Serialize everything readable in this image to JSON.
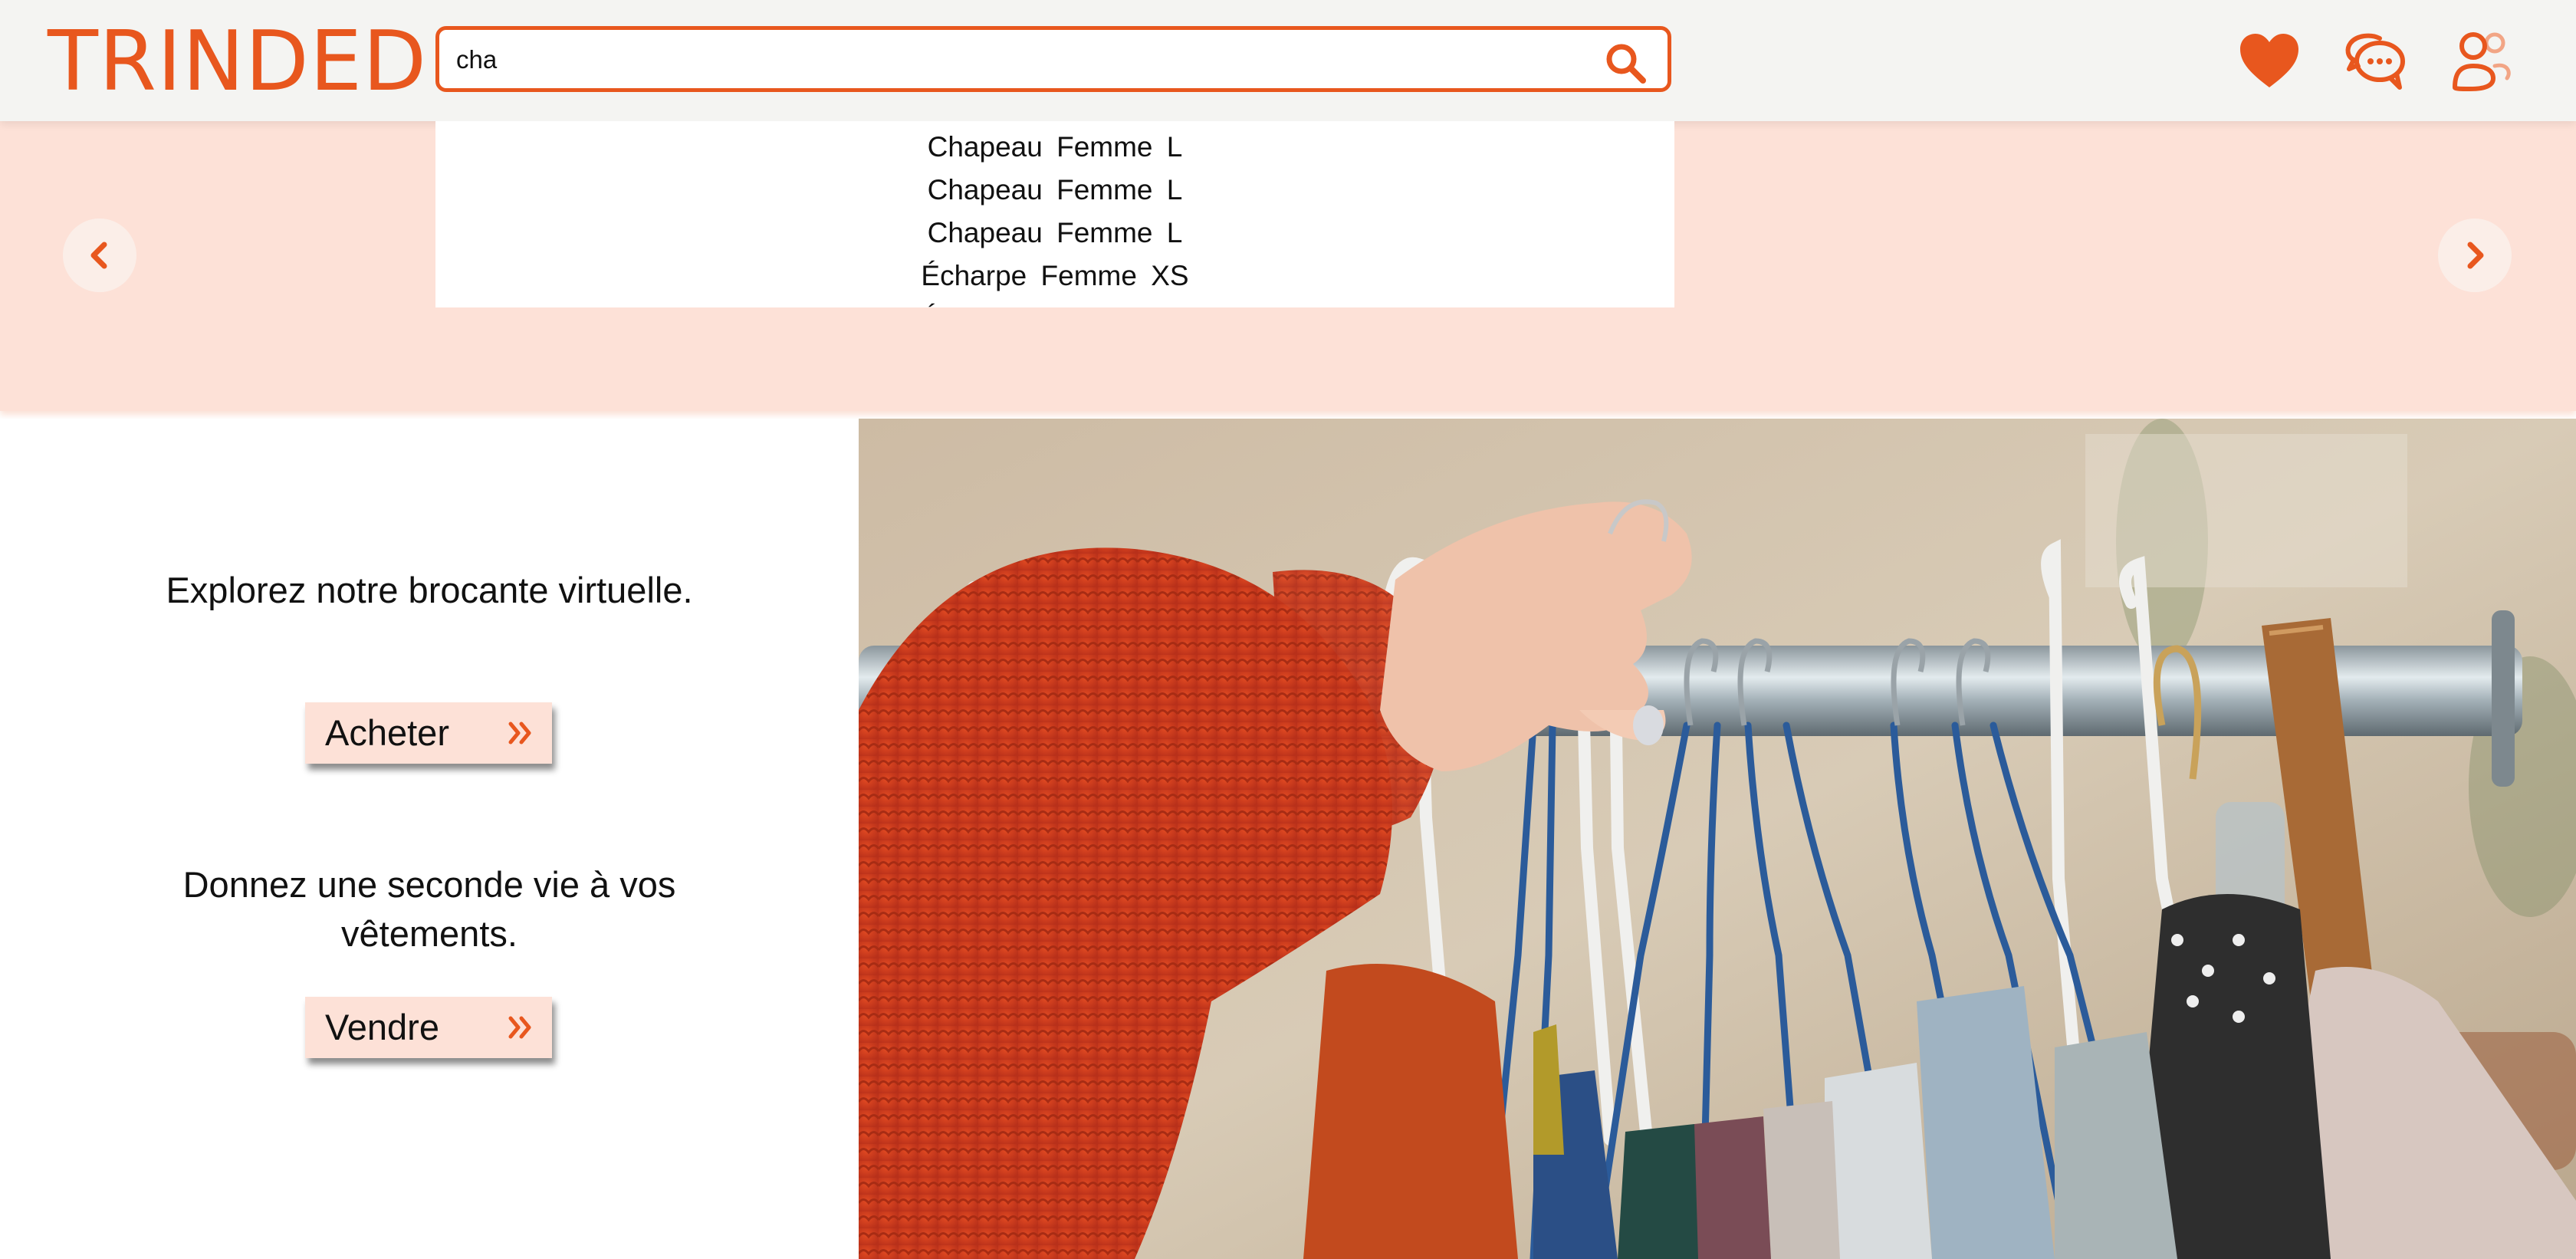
{
  "brand": {
    "name": "TRINDED",
    "accent": "#e8571e",
    "soft": "#fde1d7"
  },
  "search": {
    "value": "cha",
    "placeholder": ""
  },
  "header_icons": [
    "search-icon",
    "heart-icon",
    "chat-icon",
    "users-icon"
  ],
  "suggestions": [
    "Chapeau Femme L",
    "Chapeau Femme L",
    "Chapeau Femme L",
    "Écharpe Femme XS",
    "Écharpe Femme XS"
  ],
  "carousel": {
    "prev_icon": "chevron-left-icon",
    "next_icon": "chevron-right-icon"
  },
  "main": {
    "buy_text": "Explorez notre brocante virtuelle.",
    "buy_label": "Acheter",
    "sell_text": "Donnez une seconde vie à vos vêtements.",
    "sell_label": "Vendre"
  }
}
